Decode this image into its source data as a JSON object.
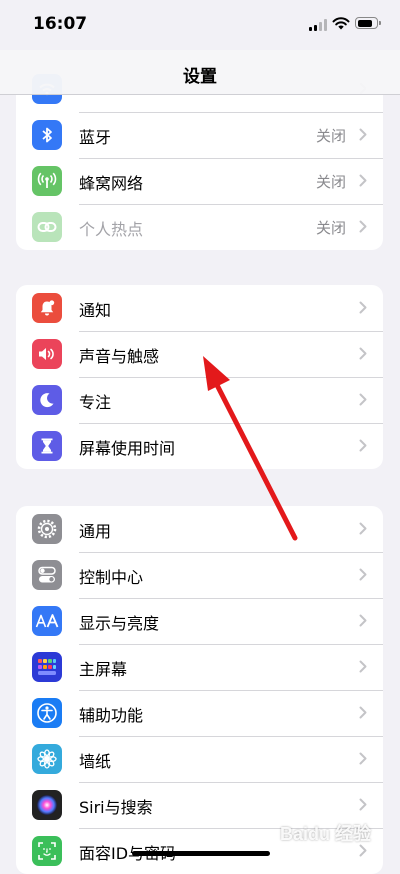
{
  "status_bar": {
    "time": "16:07",
    "battery_level": 0.7
  },
  "nav": {
    "title": "设置"
  },
  "group_network": [
    {
      "label": "",
      "value": "",
      "icon": "wifi-icon",
      "color": "#3478f6"
    },
    {
      "label": "蓝牙",
      "value": "关闭",
      "icon": "bluetooth-icon",
      "color": "#3478f6"
    },
    {
      "label": "蜂窝网络",
      "value": "关闭",
      "icon": "cellular-icon",
      "color": "#65c466"
    },
    {
      "label": "个人热点",
      "value": "关闭",
      "icon": "hotspot-icon",
      "color": "#65c466",
      "disabled": true
    }
  ],
  "group_notifications": [
    {
      "label": "通知",
      "icon": "bell-icon",
      "color": "#eb4d3d"
    },
    {
      "label": "声音与触感",
      "icon": "speaker-icon",
      "color": "#eb445a"
    },
    {
      "label": "专注",
      "icon": "moon-icon",
      "color": "#5e5ce6"
    },
    {
      "label": "屏幕使用时间",
      "icon": "hourglass-icon",
      "color": "#5e5ce6"
    }
  ],
  "group_general": [
    {
      "label": "通用",
      "icon": "gear-icon",
      "color": "#8e8e93"
    },
    {
      "label": "控制中心",
      "icon": "toggles-icon",
      "color": "#8e8e93"
    },
    {
      "label": "显示与亮度",
      "icon": "text-size-icon",
      "color": "#3478f6"
    },
    {
      "label": "主屏幕",
      "icon": "home-grid-icon",
      "color": "#2c3ad6"
    },
    {
      "label": "辅助功能",
      "icon": "accessibility-icon",
      "color": "#1a7cf4"
    },
    {
      "label": "墙纸",
      "icon": "flower-icon",
      "color": "#34aadc"
    },
    {
      "label": "Siri与搜索",
      "icon": "siri-icon",
      "color": "#222222"
    },
    {
      "label": "面容ID与密码",
      "icon": "faceid-icon",
      "color": "#3bbf5a"
    }
  ],
  "annotation": {
    "arrow_color": "#e3191b"
  },
  "watermark": {
    "text": "Baidu 经验"
  }
}
